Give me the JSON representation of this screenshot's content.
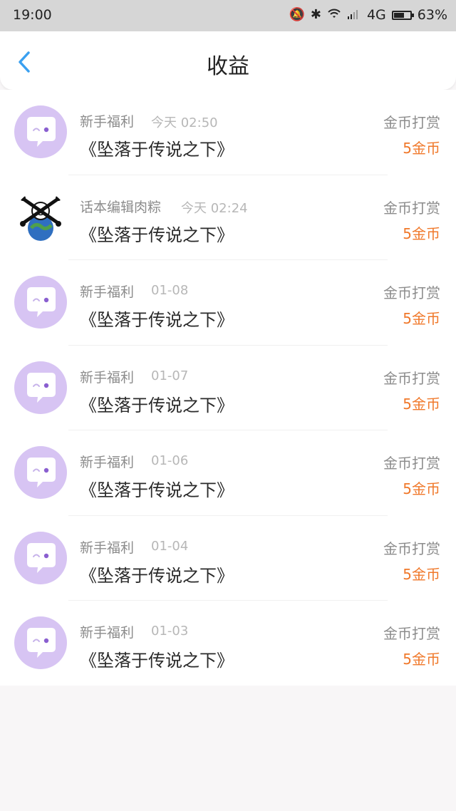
{
  "status": {
    "time": "19:00",
    "network": "4G",
    "battery": "63%",
    "battery_level": 0.63
  },
  "header": {
    "title": "收益"
  },
  "items": [
    {
      "source": "新手福利",
      "time": "今天 02:50",
      "book": "《坠落于传说之下》",
      "type": "金币打赏",
      "amount": "5金币"
    },
    {
      "source": "话本编辑肉粽",
      "time": "今天 02:24",
      "book": "《坠落于传说之下》",
      "type": "金币打赏",
      "amount": "5金币"
    },
    {
      "source": "新手福利",
      "time": "01-08",
      "book": "《坠落于传说之下》",
      "type": "金币打赏",
      "amount": "5金币"
    },
    {
      "source": "新手福利",
      "time": "01-07",
      "book": "《坠落于传说之下》",
      "type": "金币打赏",
      "amount": "5金币"
    },
    {
      "source": "新手福利",
      "time": "01-06",
      "book": "《坠落于传说之下》",
      "type": "金币打赏",
      "amount": "5金币"
    },
    {
      "source": "新手福利",
      "time": "01-04",
      "book": "《坠落于传说之下》",
      "type": "金币打赏",
      "amount": "5金币"
    },
    {
      "source": "新手福利",
      "time": "01-03",
      "book": "《坠落于传说之下》",
      "type": "金币打赏",
      "amount": "5金币"
    }
  ],
  "colors": {
    "accent": "#3aa0f0",
    "amount": "#f0782a",
    "avatar": "#d7c4f3"
  }
}
